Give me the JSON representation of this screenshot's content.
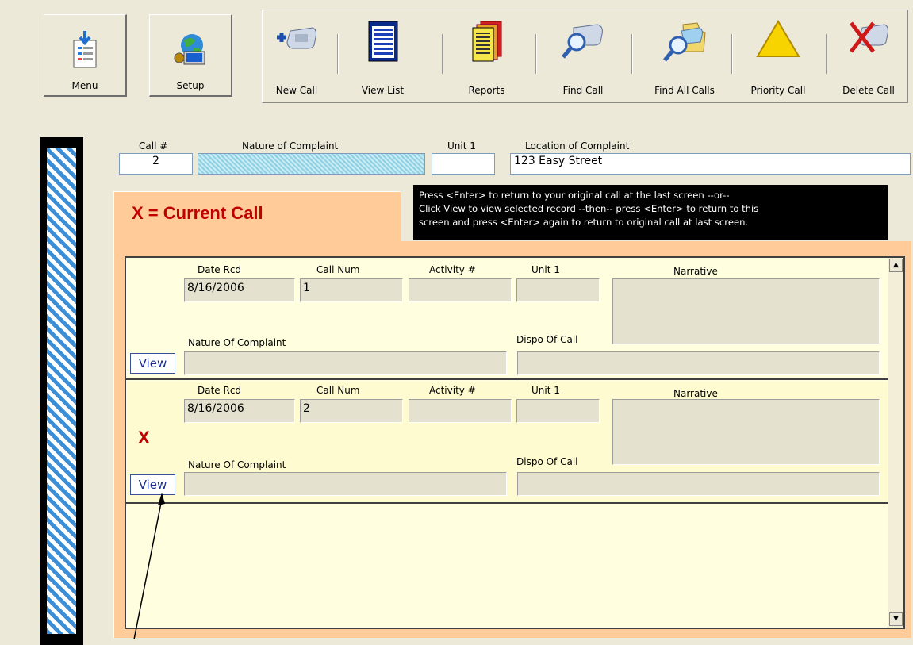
{
  "toolbar": {
    "menu": "Menu",
    "setup": "Setup",
    "new_call": "New Call",
    "view_list": "View List",
    "reports": "Reports",
    "find_call": "Find Call",
    "find_all_calls": "Find All Calls",
    "priority_call": "Priority Call",
    "delete_call": "Delete Call"
  },
  "header": {
    "call_num_label": "Call #",
    "call_num_value": "2",
    "nature_label": "Nature of Complaint",
    "nature_value": "",
    "unit_label": "Unit 1",
    "unit_value": "",
    "location_label": "Location of Complaint",
    "location_value": "123 Easy Street"
  },
  "current_call_legend": "X = Current Call",
  "help_lines": [
    "Press <Enter> to return to your original call at the last screen --or--",
    "Click View to view selected record --then-- press <Enter> to return to this",
    "screen and press <Enter> again to return to original call at last screen."
  ],
  "record_labels": {
    "date": "Date Rcd",
    "call_num": "Call Num",
    "activity": "Activity #",
    "unit": "Unit 1",
    "narrative": "Narrative",
    "nature": "Nature Of Complaint",
    "dispo": "Dispo Of Call"
  },
  "records": [
    {
      "date": "8/16/2006",
      "call_num": "1",
      "activity": "",
      "unit": "",
      "narrative": "",
      "nature": "",
      "dispo": "",
      "current": "",
      "view": "View"
    },
    {
      "date": "8/16/2006",
      "call_num": "2",
      "activity": "",
      "unit": "",
      "narrative": "",
      "nature": "",
      "dispo": "",
      "current": "X",
      "view": "View"
    }
  ],
  "scroll": {
    "up": "▲",
    "down": "▼"
  },
  "colors": {
    "accent_red": "#c00000",
    "panel_orange": "#ffcc99",
    "list_bg": "#ffffe0",
    "stripe_blue": "#3a8fd8"
  }
}
